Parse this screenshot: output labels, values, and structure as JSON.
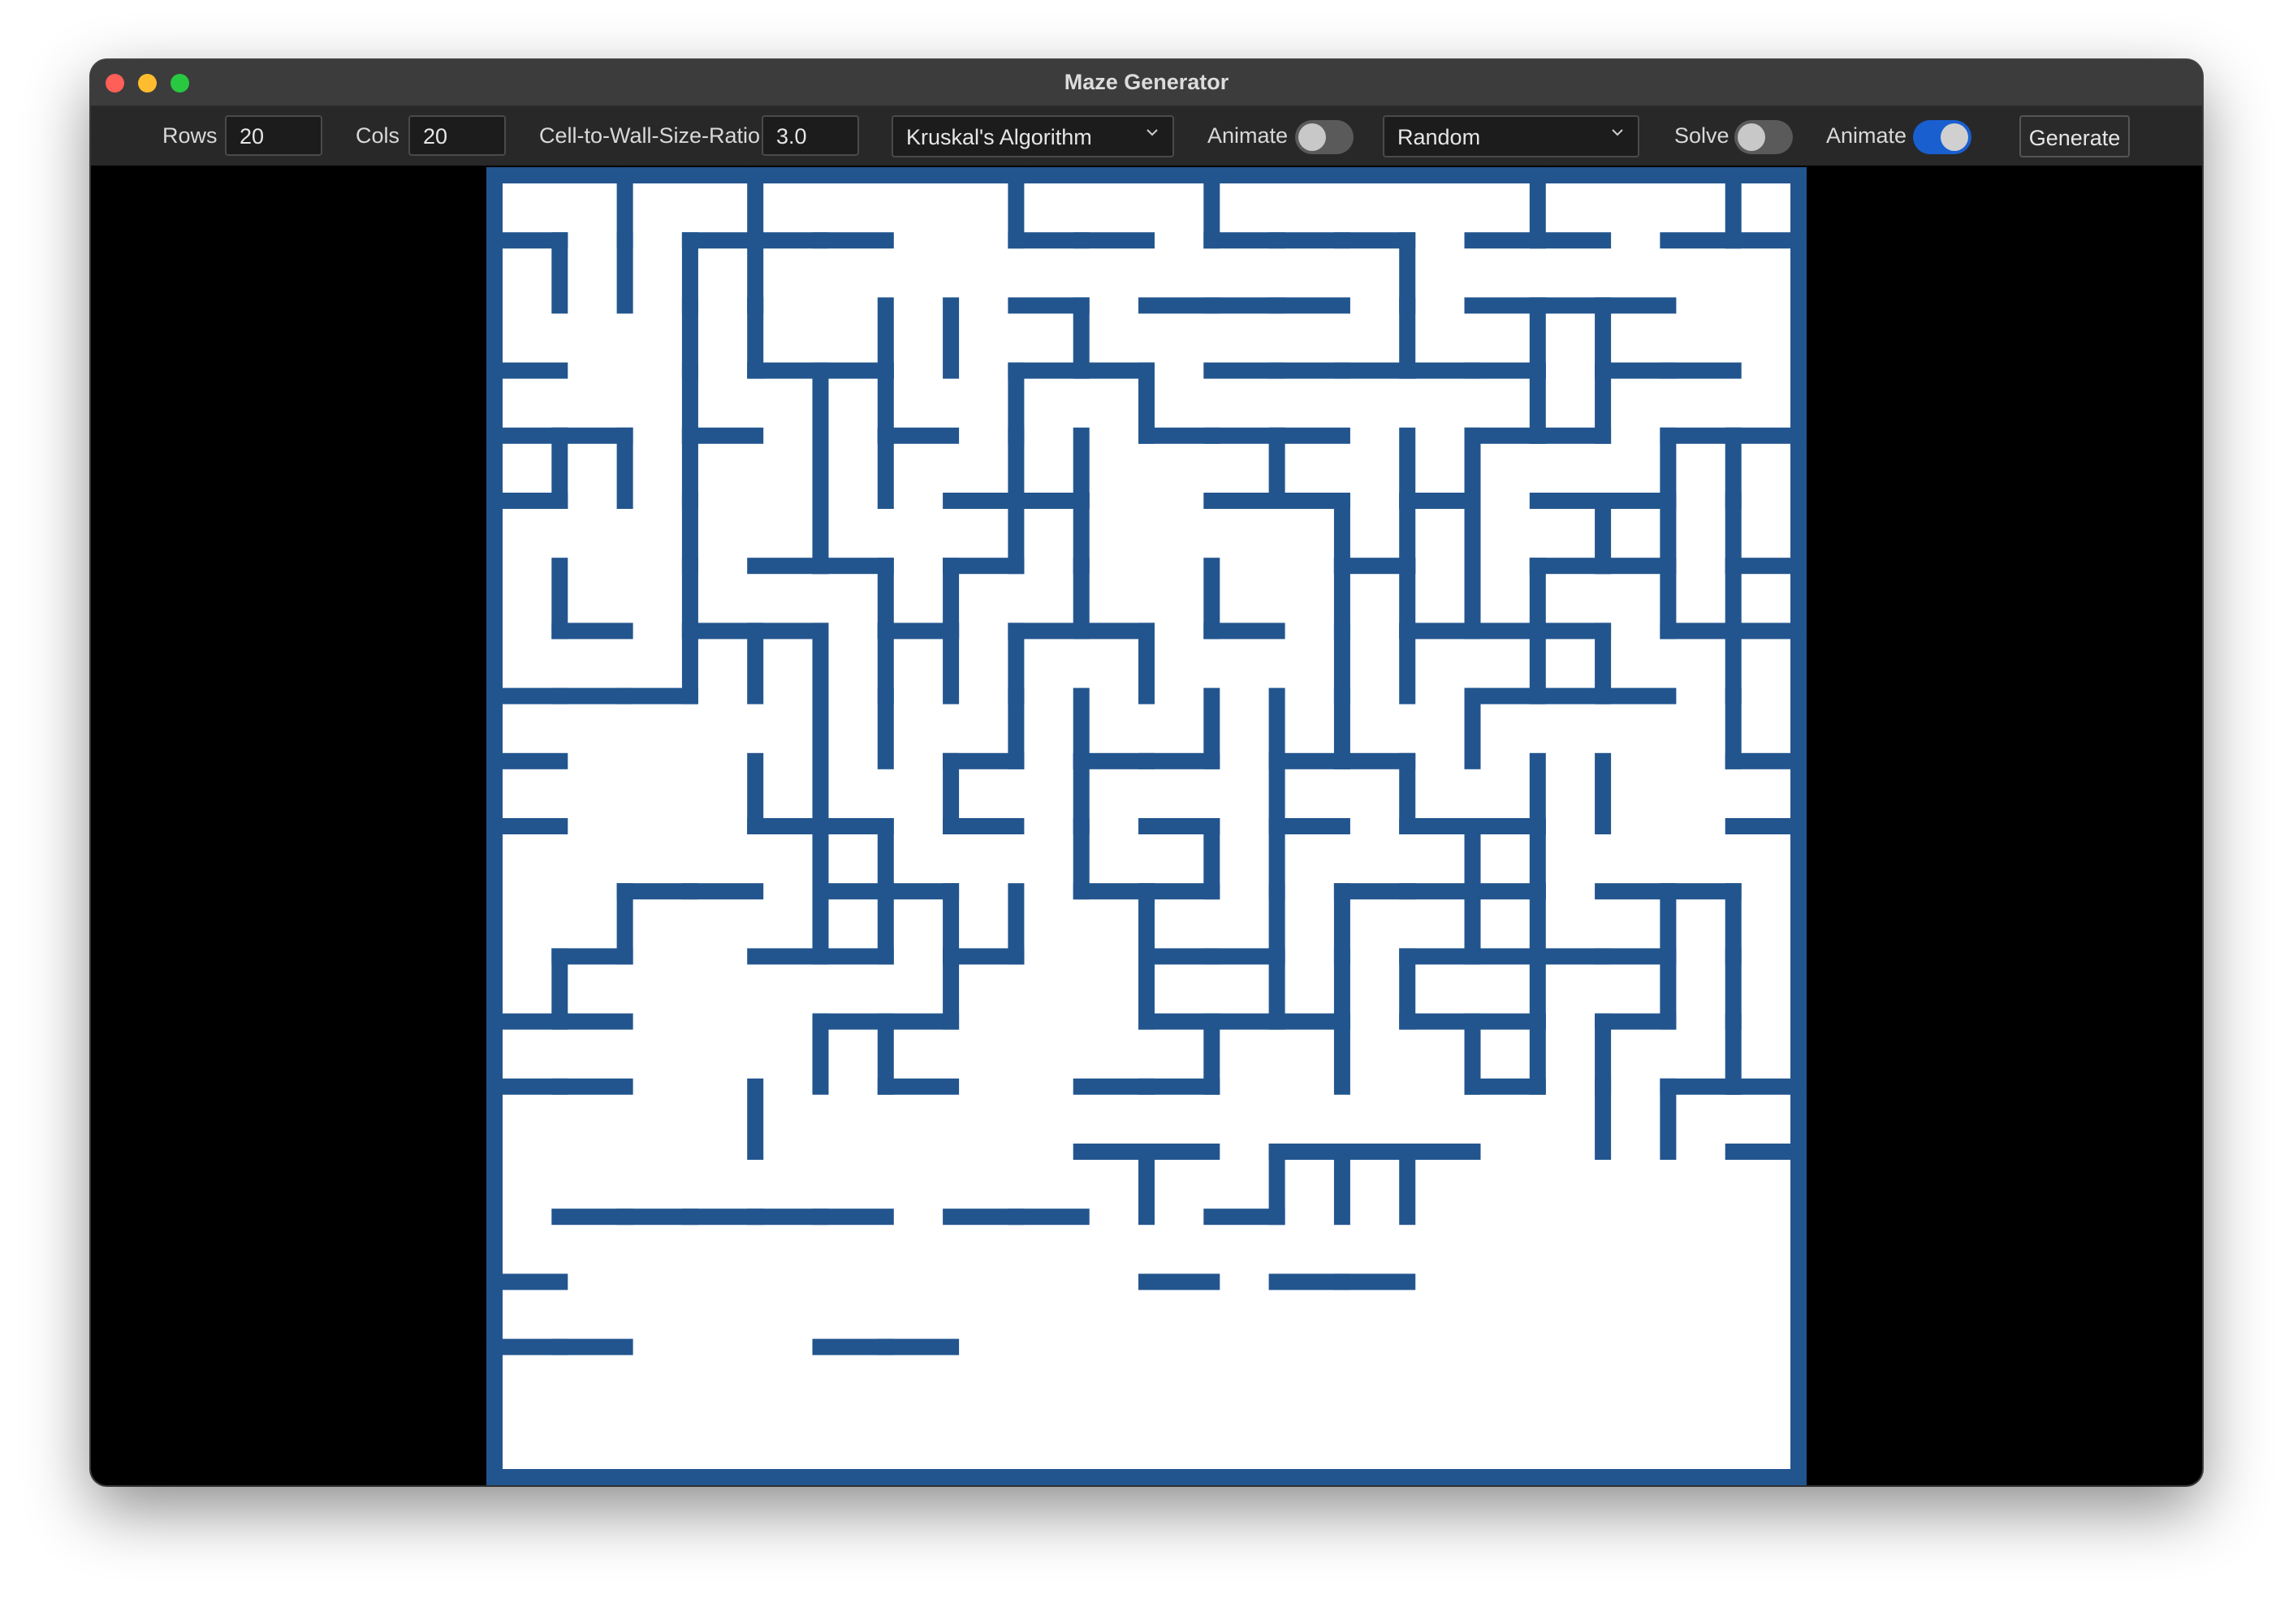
{
  "window": {
    "title": "Maze Generator"
  },
  "toolbar": {
    "rows_label": "Rows",
    "rows_value": "20",
    "cols_label": "Cols",
    "cols_value": "20",
    "ratio_label": "Cell-to-Wall-Size-Ratio",
    "ratio_value": "3.0",
    "algorithm_selected": "Kruskal's Algorithm",
    "generate_animate_label": "Animate",
    "generate_animate_on": false,
    "start_mode_selected": "Random",
    "solve_label": "Solve",
    "solve_on": false,
    "solve_animate_label": "Animate",
    "solve_animate_on": true,
    "generate_button": "Generate"
  },
  "maze": {
    "rows": 20,
    "cols": 20,
    "wall_color": "#22558e",
    "path_color": "#ffffff",
    "h_walls": [
      [
        1,
        0,
        0,
        1,
        1,
        1,
        0,
        0,
        1,
        1,
        0,
        1,
        1,
        1,
        0,
        1,
        1,
        0,
        1,
        1
      ],
      [
        0,
        0,
        0,
        0,
        0,
        0,
        0,
        0,
        1,
        0,
        1,
        1,
        1,
        0,
        0,
        1,
        1,
        1,
        0,
        0
      ],
      [
        1,
        0,
        0,
        0,
        1,
        1,
        0,
        0,
        1,
        1,
        0,
        1,
        1,
        1,
        1,
        1,
        0,
        1,
        1,
        0
      ],
      [
        1,
        1,
        0,
        1,
        0,
        0,
        1,
        0,
        0,
        0,
        1,
        1,
        1,
        0,
        0,
        1,
        1,
        0,
        1,
        1
      ],
      [
        1,
        0,
        0,
        0,
        0,
        0,
        0,
        1,
        1,
        0,
        0,
        1,
        1,
        0,
        1,
        0,
        1,
        1,
        0,
        0
      ],
      [
        0,
        0,
        0,
        0,
        1,
        1,
        0,
        1,
        0,
        0,
        0,
        0,
        0,
        1,
        0,
        0,
        1,
        1,
        0,
        1
      ],
      [
        0,
        1,
        0,
        1,
        1,
        0,
        1,
        0,
        1,
        1,
        0,
        1,
        0,
        0,
        1,
        1,
        1,
        0,
        1,
        1
      ],
      [
        1,
        1,
        1,
        0,
        0,
        0,
        0,
        0,
        0,
        0,
        0,
        0,
        0,
        0,
        0,
        1,
        1,
        1,
        0,
        0
      ],
      [
        1,
        0,
        0,
        0,
        0,
        0,
        0,
        1,
        0,
        1,
        1,
        0,
        1,
        1,
        0,
        0,
        0,
        0,
        0,
        1
      ],
      [
        1,
        0,
        0,
        0,
        1,
        1,
        0,
        1,
        0,
        0,
        1,
        0,
        1,
        0,
        1,
        1,
        0,
        0,
        0,
        1
      ],
      [
        0,
        0,
        1,
        1,
        0,
        1,
        1,
        0,
        0,
        1,
        1,
        0,
        0,
        1,
        1,
        1,
        0,
        1,
        1,
        0
      ],
      [
        0,
        1,
        0,
        0,
        1,
        1,
        0,
        1,
        0,
        0,
        1,
        1,
        0,
        0,
        1,
        1,
        1,
        1,
        0,
        0
      ],
      [
        1,
        1,
        0,
        0,
        0,
        1,
        1,
        0,
        0,
        0,
        1,
        1,
        1,
        0,
        1,
        1,
        0,
        1,
        0,
        0
      ],
      [
        1,
        1,
        0,
        0,
        0,
        0,
        1,
        0,
        0,
        1,
        1,
        0,
        0,
        0,
        0,
        1,
        0,
        0,
        1,
        1
      ],
      [
        0,
        0,
        0,
        0,
        0,
        0,
        0,
        0,
        0,
        1,
        1,
        0,
        1,
        1,
        1,
        0,
        0,
        0,
        0,
        1
      ],
      [
        0,
        1,
        1,
        1,
        1,
        1,
        0,
        1,
        1,
        0,
        0,
        1,
        0,
        0,
        0,
        0,
        0,
        0,
        0,
        0
      ],
      [
        1,
        0,
        0,
        0,
        0,
        0,
        0,
        0,
        0,
        0,
        1,
        0,
        1,
        1,
        0,
        0,
        0,
        0,
        0,
        0
      ],
      [
        1,
        1,
        0,
        0,
        0,
        1,
        1,
        0,
        0,
        0,
        0,
        0,
        0,
        0,
        0,
        0,
        0,
        0,
        0,
        0
      ],
      [
        0,
        0,
        0,
        0,
        0,
        0,
        0,
        0,
        0,
        0,
        0,
        0,
        0,
        0,
        0,
        0,
        0,
        0,
        0,
        0
      ],
      [
        0,
        0,
        0,
        0,
        0,
        0,
        0,
        0,
        0,
        0,
        0,
        0,
        0,
        0,
        0,
        0,
        0,
        0,
        0,
        0
      ]
    ],
    "v_walls": [
      [
        0,
        1,
        0,
        1,
        0,
        0,
        0,
        1,
        0,
        0,
        1,
        0,
        0,
        0,
        0,
        1,
        0,
        0,
        1
      ],
      [
        1,
        1,
        1,
        1,
        0,
        0,
        0,
        0,
        0,
        0,
        0,
        0,
        0,
        1,
        0,
        0,
        0,
        0,
        0
      ],
      [
        0,
        0,
        1,
        1,
        0,
        1,
        1,
        0,
        1,
        0,
        0,
        0,
        0,
        1,
        0,
        1,
        1,
        0,
        0
      ],
      [
        0,
        0,
        1,
        0,
        1,
        1,
        0,
        1,
        0,
        1,
        0,
        0,
        0,
        0,
        0,
        1,
        1,
        0,
        0
      ],
      [
        1,
        1,
        1,
        0,
        1,
        1,
        0,
        1,
        1,
        0,
        0,
        1,
        0,
        1,
        1,
        0,
        0,
        1,
        1
      ],
      [
        0,
        0,
        1,
        0,
        1,
        0,
        0,
        1,
        1,
        0,
        0,
        0,
        1,
        1,
        1,
        0,
        1,
        1,
        1
      ],
      [
        1,
        0,
        1,
        0,
        0,
        1,
        1,
        0,
        1,
        0,
        1,
        0,
        1,
        1,
        1,
        1,
        0,
        1,
        1
      ],
      [
        0,
        0,
        1,
        1,
        1,
        1,
        1,
        1,
        0,
        1,
        0,
        0,
        1,
        1,
        0,
        1,
        1,
        0,
        1
      ],
      [
        0,
        0,
        0,
        0,
        1,
        1,
        0,
        1,
        1,
        0,
        1,
        1,
        1,
        0,
        1,
        0,
        0,
        0,
        1
      ],
      [
        0,
        0,
        0,
        1,
        1,
        0,
        1,
        0,
        1,
        0,
        0,
        1,
        0,
        1,
        0,
        1,
        1,
        0,
        0
      ],
      [
        0,
        0,
        0,
        0,
        1,
        1,
        0,
        0,
        1,
        0,
        1,
        1,
        0,
        0,
        1,
        1,
        0,
        0,
        0
      ],
      [
        0,
        1,
        0,
        0,
        1,
        1,
        1,
        1,
        0,
        1,
        0,
        1,
        1,
        0,
        1,
        1,
        0,
        1,
        1
      ],
      [
        1,
        0,
        0,
        0,
        0,
        0,
        1,
        0,
        0,
        1,
        0,
        1,
        1,
        1,
        0,
        1,
        0,
        1,
        1
      ],
      [
        0,
        0,
        0,
        0,
        1,
        1,
        0,
        0,
        0,
        0,
        1,
        0,
        1,
        0,
        1,
        1,
        1,
        0,
        1
      ],
      [
        0,
        0,
        0,
        1,
        0,
        0,
        0,
        0,
        0,
        0,
        0,
        0,
        0,
        0,
        0,
        0,
        1,
        1,
        0
      ],
      [
        0,
        0,
        0,
        0,
        0,
        0,
        0,
        0,
        0,
        1,
        0,
        1,
        1,
        1,
        0,
        0,
        0,
        0,
        0
      ],
      [
        0,
        0,
        0,
        0,
        0,
        0,
        0,
        0,
        0,
        0,
        0,
        0,
        0,
        0,
        0,
        0,
        0,
        0,
        0
      ],
      [
        0,
        0,
        0,
        0,
        0,
        0,
        0,
        0,
        0,
        0,
        0,
        0,
        0,
        0,
        0,
        0,
        0,
        0,
        0
      ],
      [
        0,
        0,
        0,
        0,
        0,
        0,
        0,
        0,
        0,
        0,
        0,
        0,
        0,
        0,
        0,
        0,
        0,
        0,
        0
      ],
      [
        0,
        0,
        0,
        0,
        0,
        0,
        0,
        0,
        0,
        0,
        0,
        0,
        0,
        0,
        0,
        0,
        0,
        0,
        0
      ]
    ]
  }
}
